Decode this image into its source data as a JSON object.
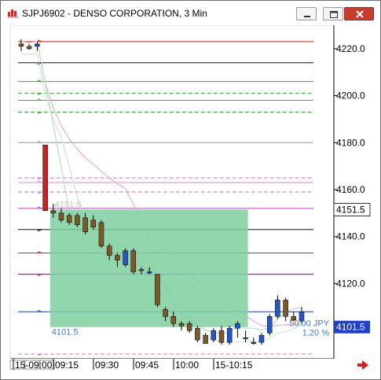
{
  "window": {
    "title": "SJPJ6902 - DENSO CORPORATION, 3 Min"
  },
  "chart_data": {
    "type": "candlestick",
    "symbol": "SJPJ6902",
    "interval": "3 Min",
    "ylim": [
      4088,
      4230
    ],
    "price_ticks": [
      "4220.0",
      "4200.0",
      "4180.0",
      "4160.0",
      "4140.0",
      "4120.0"
    ],
    "price_tick_values": [
      4220,
      4200,
      4180,
      4160,
      4140,
      4120
    ],
    "time_ticks": [
      "15-09:00",
      "09:15",
      "09:30",
      "09:45",
      "10:00",
      "15-10:15"
    ],
    "time_tick_index": [
      0,
      5,
      10,
      15,
      20,
      25
    ],
    "last_price_tag": "4151.5",
    "last_price_value": 4151.5,
    "current_price_tag": "4101.5",
    "current_price_value": 4101.5,
    "colors": {
      "up": "#2457c7",
      "down": "#7a5a2a",
      "spike": "#cc1f1f",
      "zone": "#7fcfa0"
    },
    "candles": [
      {
        "o": 4222,
        "h": 4224,
        "l": 4219,
        "c": 4221
      },
      {
        "o": 4221,
        "h": 4222,
        "l": 4219.5,
        "c": 4220
      },
      {
        "o": 4221,
        "h": 4223,
        "l": 4219,
        "c": 4222
      },
      {
        "o": 4179,
        "h": 4179,
        "l": 4151,
        "c": 4151
      },
      {
        "o": 4151,
        "h": 4154,
        "l": 4148,
        "c": 4150
      },
      {
        "o": 4150,
        "h": 4152,
        "l": 4146,
        "c": 4147
      },
      {
        "o": 4149,
        "h": 4150,
        "l": 4145,
        "c": 4146
      },
      {
        "o": 4149,
        "h": 4150,
        "l": 4144,
        "c": 4145
      },
      {
        "o": 4148,
        "h": 4150,
        "l": 4141,
        "c": 4142
      },
      {
        "o": 4147,
        "h": 4149,
        "l": 4143,
        "c": 4144
      },
      {
        "o": 4146,
        "h": 4147,
        "l": 4135,
        "c": 4136
      },
      {
        "o": 4136,
        "h": 4137,
        "l": 4130,
        "c": 4132
      },
      {
        "o": 4132,
        "h": 4133,
        "l": 4127,
        "c": 4130
      },
      {
        "o": 4128,
        "h": 4135,
        "l": 4127,
        "c": 4134
      },
      {
        "o": 4134,
        "h": 4135,
        "l": 4124,
        "c": 4125
      },
      {
        "o": 4126,
        "h": 4127,
        "l": 4124,
        "c": 4125.5
      },
      {
        "o": 4125,
        "h": 4127,
        "l": 4124,
        "c": 4125
      },
      {
        "o": 4124,
        "h": 4124,
        "l": 4110,
        "c": 4111
      },
      {
        "o": 4109,
        "h": 4110,
        "l": 4104,
        "c": 4106
      },
      {
        "o": 4106,
        "h": 4108,
        "l": 4101.5,
        "c": 4103
      },
      {
        "o": 4103,
        "h": 4104,
        "l": 4100,
        "c": 4102
      },
      {
        "o": 4103,
        "h": 4104,
        "l": 4099,
        "c": 4100
      },
      {
        "o": 4101,
        "h": 4102,
        "l": 4095,
        "c": 4096
      },
      {
        "o": 4098,
        "h": 4099,
        "l": 4095,
        "c": 4094.5
      },
      {
        "o": 4096,
        "h": 4101,
        "l": 4095,
        "c": 4100
      },
      {
        "o": 4100,
        "h": 4102,
        "l": 4094,
        "c": 4095
      },
      {
        "o": 4095,
        "h": 4102,
        "l": 4094,
        "c": 4101
      },
      {
        "o": 4101,
        "h": 4104,
        "l": 4097,
        "c": 4103
      },
      {
        "o": 4097,
        "h": 4100,
        "l": 4095,
        "c": 4097
      },
      {
        "o": 4095,
        "h": 4097,
        "l": 4094,
        "c": 4095
      },
      {
        "o": 4095,
        "h": 4099,
        "l": 4094,
        "c": 4098
      },
      {
        "o": 4099,
        "h": 4107,
        "l": 4098,
        "c": 4106
      },
      {
        "o": 4106,
        "h": 4115,
        "l": 4105,
        "c": 4113
      },
      {
        "o": 4113,
        "h": 4114,
        "l": 4104,
        "c": 4106
      },
      {
        "o": 4106,
        "h": 4108,
        "l": 4104,
        "c": 4104.5
      },
      {
        "o": 4104,
        "h": 4110,
        "l": 4103,
        "c": 4108
      }
    ],
    "levels": [
      {
        "value": 4223,
        "color": "#cc1f1f",
        "dash": false
      },
      {
        "value": 4214,
        "color": "#111111",
        "dash": false
      },
      {
        "value": 4206,
        "color": "#2ea82e",
        "dash": false
      },
      {
        "value": 4201,
        "color": "#2ea82e",
        "dash": true
      },
      {
        "value": 4198,
        "color": "#20c020",
        "dash": false
      },
      {
        "value": 4193,
        "color": "#2ea82e",
        "dash": true
      },
      {
        "value": 4180,
        "color": "#999999",
        "dash": false
      },
      {
        "value": 4165,
        "color": "#d070d0",
        "dash": true
      },
      {
        "value": 4163,
        "color": "#e080e0",
        "dash": false
      },
      {
        "value": 4159,
        "color": "#c070c0",
        "dash": true
      },
      {
        "value": 4152,
        "color": "#c040c0",
        "dash": false
      },
      {
        "value": 4143,
        "color": "#111111",
        "dash": false
      },
      {
        "value": 4133,
        "color": "#cc1f1f",
        "dash": false
      },
      {
        "value": 4124,
        "color": "#7a1f7a",
        "dash": false
      },
      {
        "value": 4108,
        "color": "#1f3fcf",
        "dash": false
      },
      {
        "value": 4090,
        "color": "#d070d0",
        "dash": true
      }
    ],
    "zone": {
      "from_index": 4,
      "to_index": 28,
      "top": 4151.5,
      "bottom": 4101.5
    },
    "zone_labels": {
      "top_left": "4151.5",
      "bottom_left": "4101.5",
      "right_amount": "50.00 JPY",
      "right_percent": "1.20 %"
    }
  }
}
